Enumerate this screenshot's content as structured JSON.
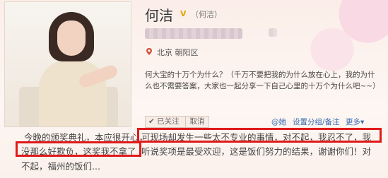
{
  "profile": {
    "name": "何洁",
    "verified_mark": "V",
    "nickname": "（何洁）",
    "location": "北京 朝阳区",
    "bio": "何大宝的十万个为什么？（千万不要把我的为什么放在心上，我的为什么也不需要答案，大家也一起分享一下自己心里的十万个为什么吧~~）"
  },
  "actions": {
    "follow_label": "✔ 已关注",
    "cancel_label": "取消",
    "at_label": "@她",
    "settings_label": "设置分组/备注",
    "more_label": "更多▾"
  },
  "post": {
    "line1_left": "今晚的颁奖典礼，本应很开心，",
    "line1_right": "可现场却发生一些太不专业的事情，对不起，我忍不了，我",
    "line2_left": "没那么好欺负，这奖我不拿了",
    "line2_right": "听说奖项是最受欢迎，这是饭们努力的结果，谢谢你们！对",
    "line3": "不起，福州的饭们..."
  },
  "colors": {
    "highlight": "#e01a1a",
    "link": "#3a6ab0"
  },
  "icons": {
    "location": "location-pin-icon"
  }
}
